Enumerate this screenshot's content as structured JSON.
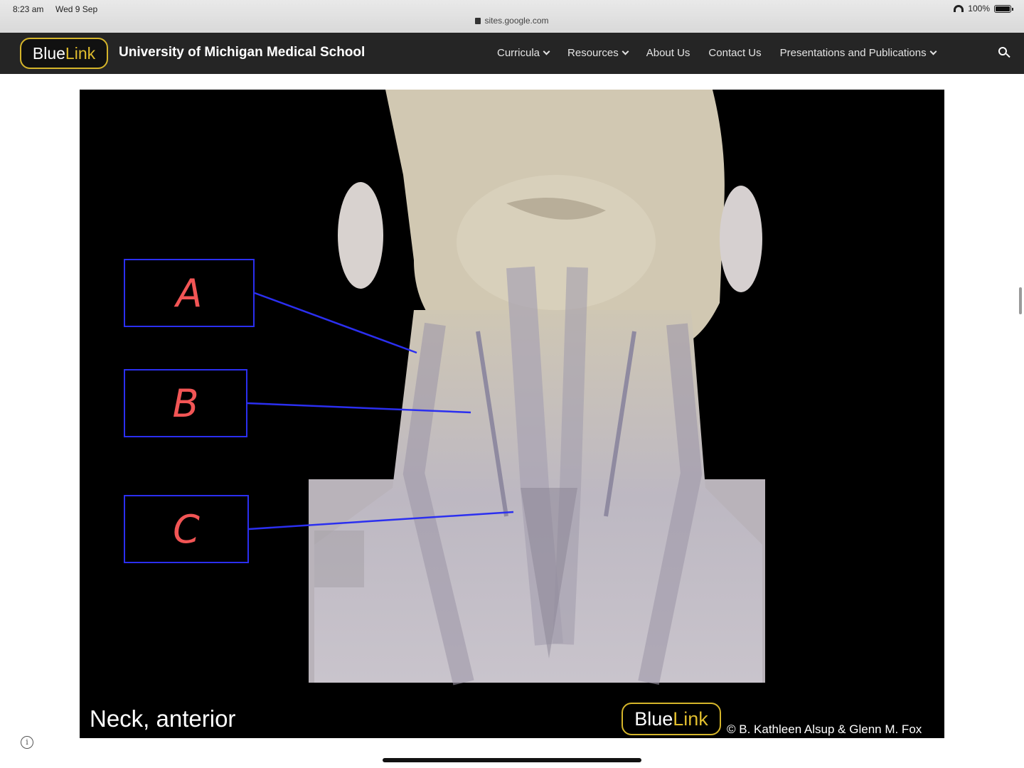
{
  "status_bar": {
    "time": "8:23 am",
    "date": "Wed 9 Sep",
    "url": "sites.google.com",
    "battery": "100%"
  },
  "header": {
    "logo_blue": "Blue",
    "logo_link": "Link",
    "site_title": "University of Michigan Medical School",
    "nav": [
      {
        "label": "Curricula",
        "icon": "chevron-down-icon"
      },
      {
        "label": "Resources",
        "icon": "chevron-down-icon"
      },
      {
        "label": "About Us"
      },
      {
        "label": "Contact Us"
      },
      {
        "label": "Presentations and Publications",
        "icon": "chevron-down-icon"
      }
    ],
    "search_icon": "search-icon"
  },
  "slide": {
    "labels": [
      "A",
      "B",
      "C"
    ],
    "caption": "Neck, anterior",
    "logo_blue": "Blue",
    "logo_link": "Link",
    "credit": "© B. Kathleen Alsup & Glenn M. Fox"
  },
  "colors": {
    "header_bg": "#252525",
    "logo_gold": "#d5b52a",
    "label_border": "#2b2ff0",
    "label_text": "#f25555"
  }
}
